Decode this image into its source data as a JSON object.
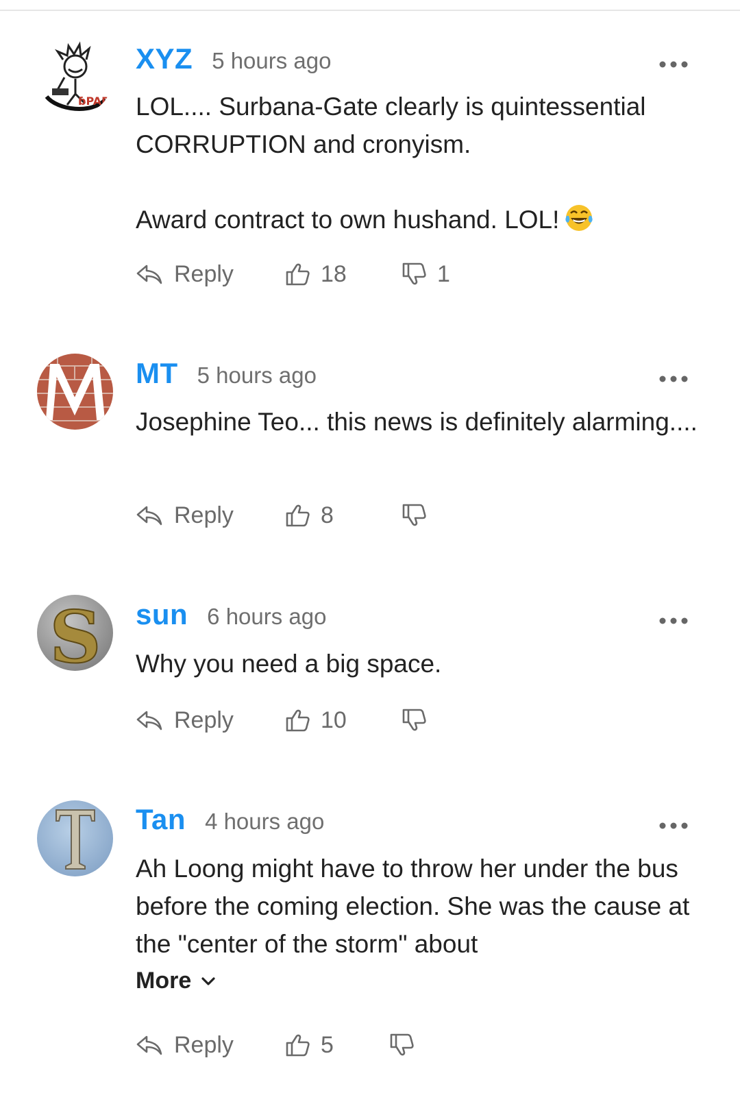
{
  "comments": [
    {
      "user": "XYZ",
      "time": "5 hours ago",
      "avatar_icon": "calvin-sticker-avatar",
      "body": [
        "LOL.... Surbana-Gate clearly is quintessential CORRUPTION and cronyism.",
        "Award contract to own hushand. LOL!"
      ],
      "emoji": "laughing-tears-emoji",
      "reply_label": "Reply",
      "likes": "18",
      "dislikes": "1"
    },
    {
      "user": "MT",
      "time": "5 hours ago",
      "avatar_icon": "letter-m-avatar",
      "body": [
        "Josephine Teo... this news is definitely alarming...."
      ],
      "reply_label": "Reply",
      "likes": "8",
      "dislikes": ""
    },
    {
      "user": "sun",
      "time": "6 hours ago",
      "avatar_icon": "letter-s-avatar",
      "body": [
        "Why you need a big space."
      ],
      "reply_label": "Reply",
      "likes": "10",
      "dislikes": ""
    },
    {
      "user": "Tan",
      "time": "4 hours ago",
      "avatar_icon": "letter-t-avatar",
      "body": [
        "Ah Loong might have to throw her under the bus before the coming election. She was the cause at the \"center of the storm\" about"
      ],
      "more_label": "More",
      "reply_label": "Reply",
      "likes": "5",
      "dislikes": ""
    }
  ],
  "colors": {
    "username": "#1a8ff0",
    "meta": "#6f6f6f",
    "text": "#222222",
    "action": "#6a6a6a"
  }
}
